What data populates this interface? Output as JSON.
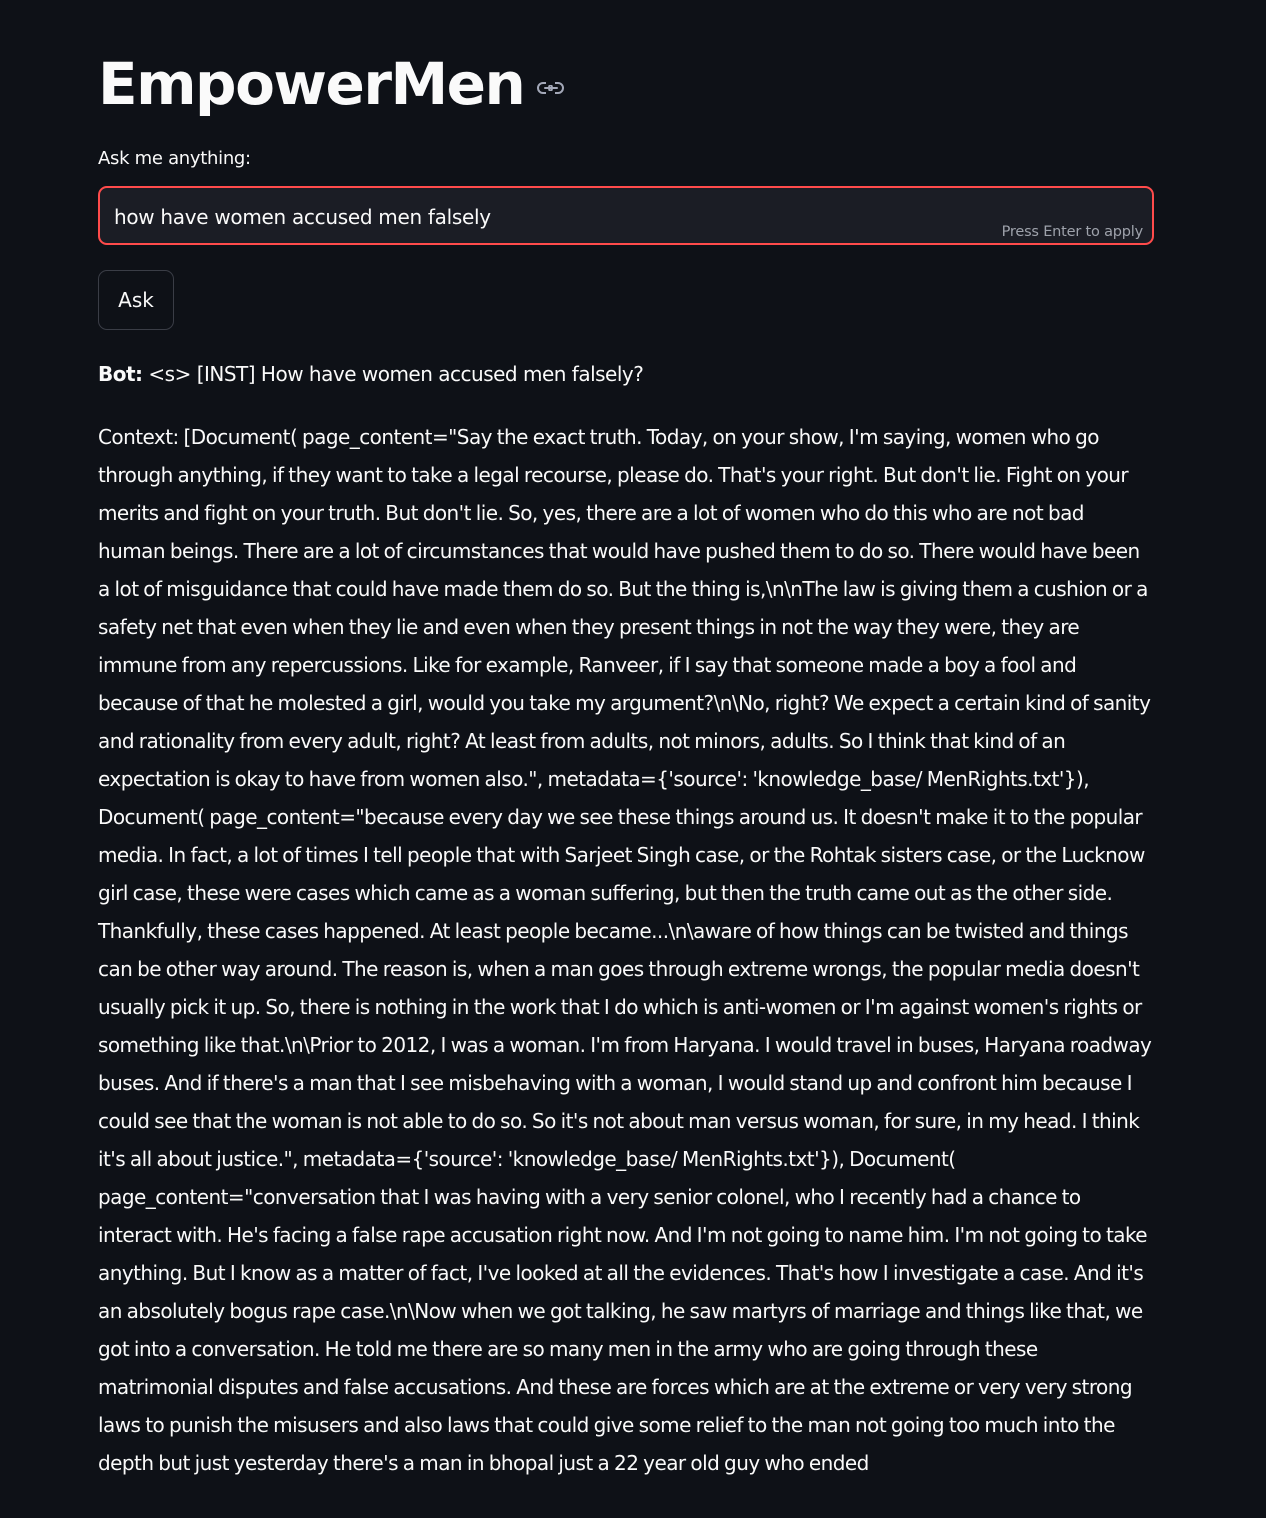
{
  "app": {
    "title": "EmpowerMen"
  },
  "query": {
    "label": "Ask me anything:",
    "value": "how have women accused men falsely",
    "hint": "Press Enter to apply"
  },
  "ask_button": {
    "label": "Ask"
  },
  "response": {
    "prefix": "Bot:",
    "question": " <s> [INST] How have women accused men falsely?",
    "context": "Context: [Document( page_content=\"Say the exact truth. Today, on your show, I'm saying, women who go through anything, if they want to take a legal recourse, please do. That's your right. But don't lie. Fight on your merits and fight on your truth. But don't lie. So, yes, there are a lot of women who do this who are not bad human beings. There are a lot of circumstances that would have pushed them to do so. There would have been a lot of misguidance that could have made them do so. But the thing is,\\n\\nThe law is giving them a cushion or a safety net that even when they lie and even when they present things in not the way they were, they are immune from any repercussions. Like for example, Ranveer, if I say that someone made a boy a fool and because of that he molested a girl, would you take my argument?\\n\\No, right? We expect a certain kind of sanity and rationality from every adult, right? At least from adults, not minors, adults. So I think that kind of an expectation is okay to have from women also.\", metadata={'source': 'knowledge_base/ MenRights.txt'}), Document( page_content=\"because every day we see these things around us. It doesn't make it to the popular media. In fact, a lot of times I tell people that with Sarjeet Singh case, or the Rohtak sisters case, or the Lucknow girl case, these were cases which came as a woman suffering, but then the truth came out as the other side. Thankfully, these cases happened. At least people became...\\n\\aware of how things can be twisted and things can be other way around. The reason is, when a man goes through extreme wrongs, the popular media doesn't usually pick it up. So, there is nothing in the work that I do which is anti-women or I'm against women's rights or something like that.\\n\\Prior to 2012, I was a woman. I'm from Haryana. I would travel in buses, Haryana roadway buses. And if there's a man that I see misbehaving with a woman, I would stand up and confront him because I could see that the woman is not able to do so. So it's not about man versus woman, for sure, in my head. I think it's all about justice.\", metadata={'source': 'knowledge_base/ MenRights.txt'}), Document( page_content=\"conversation that I was having with a very senior colonel, who I recently had a chance to interact with. He's facing a false rape accusation right now. And I'm not going to name him. I'm not going to take anything. But I know as a matter of fact, I've looked at all the evidences. That's how I investigate a case. And it's an absolutely bogus rape case.\\n\\Now when we got talking, he saw martyrs of marriage and things like that, we got into a conversation. He told me there are so many men in the army who are going through these matrimonial disputes and false accusations. And these are forces which are at the extreme or very very strong laws to punish the misusers and also laws that could give some relief to the man not going too much into the depth but just yesterday there's a man in bhopal just a 22 year old guy who ended"
  },
  "icons": {
    "heading_anchor": "link-icon"
  },
  "colors": {
    "background": "#0e1117",
    "text": "#fafafa",
    "input_focus_border": "#ff4b4b",
    "input_background": "#1b1d25",
    "hint_text": "#9ea2ab",
    "button_border": "#3a3d46"
  }
}
